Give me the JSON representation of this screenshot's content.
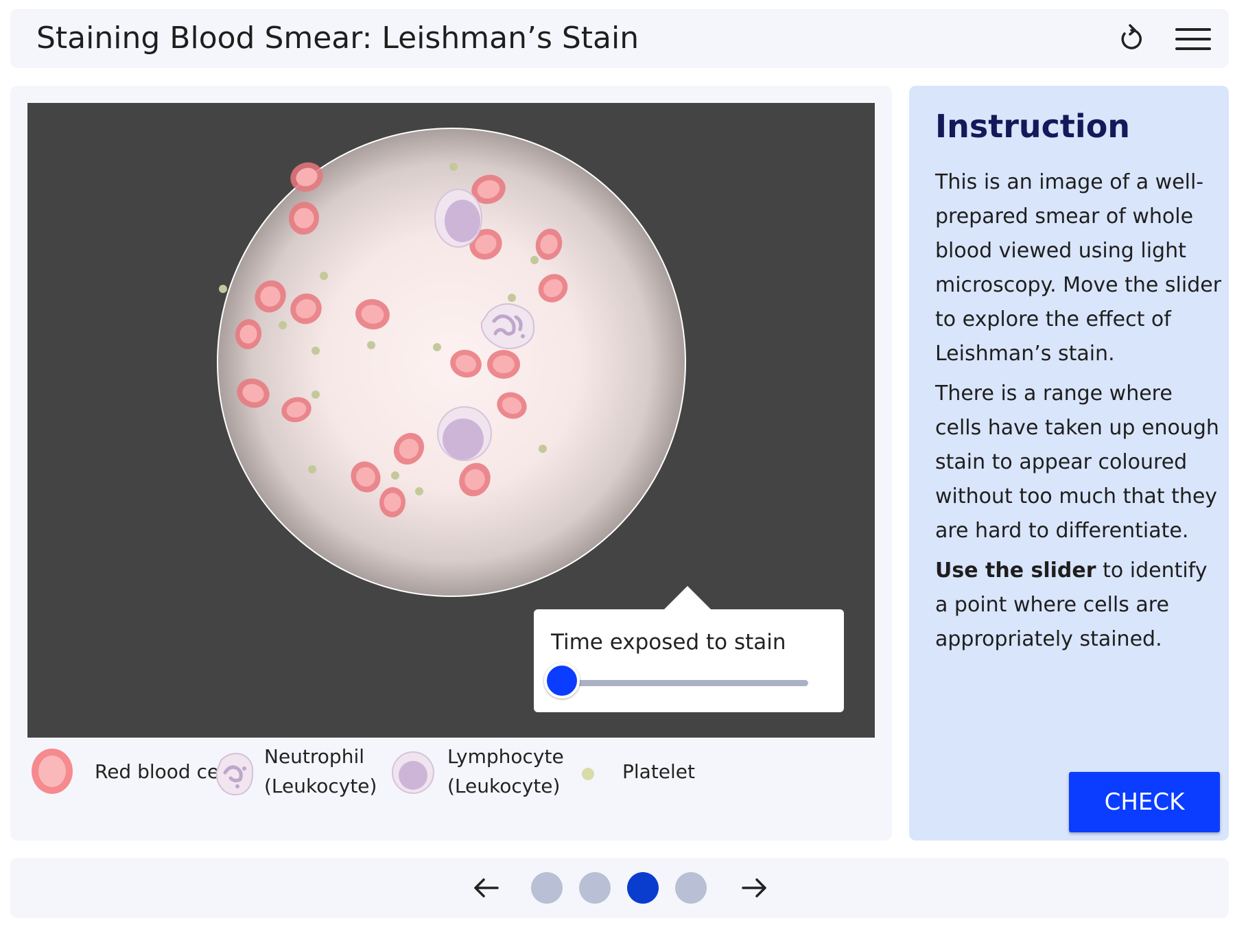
{
  "header": {
    "title": "Staining Blood Smear: Leishman’s Stain",
    "reset_icon": "reset-icon",
    "menu_icon": "hamburger-menu-icon"
  },
  "viewer": {
    "slider_label": "Time exposed to stain",
    "slider_value": 0.0
  },
  "legend": [
    {
      "label": "Red blood cell",
      "icon": "red-blood-cell-icon"
    },
    {
      "label_line1": "Neutrophil",
      "label_line2": "(Leukocyte)",
      "icon": "neutrophil-icon"
    },
    {
      "label_line1": "Lymphocyte",
      "label_line2": "(Leukocyte)",
      "icon": "lymphocyte-icon"
    },
    {
      "label": "Platelet",
      "icon": "platelet-icon"
    }
  ],
  "instruction": {
    "heading": "Instruction",
    "para1": "This is an image of a well-prepared smear of whole blood viewed using light microscopy. Move the slider to explore the effect of Leishman’s stain.",
    "para2": "There is a range where cells have taken up enough stain to appear coloured without too much that they are hard to differentiate.",
    "para3_bold": "Use the slider",
    "para3_rest": " to identify a point where cells are appropriately stained.",
    "check_label": "CHECK"
  },
  "footer": {
    "pages": 4,
    "current_page": 3,
    "prev_icon": "arrow-left-icon",
    "next_icon": "arrow-right-icon"
  },
  "colors": {
    "accent": "#0a3dff",
    "active_dot": "#0a3dce",
    "inactive_dot": "#b9bfd4",
    "panel_bg": "#f5f6fc",
    "instruction_bg": "#d9e5fb",
    "viewer_bg": "#444444",
    "heading": "#14195a"
  }
}
